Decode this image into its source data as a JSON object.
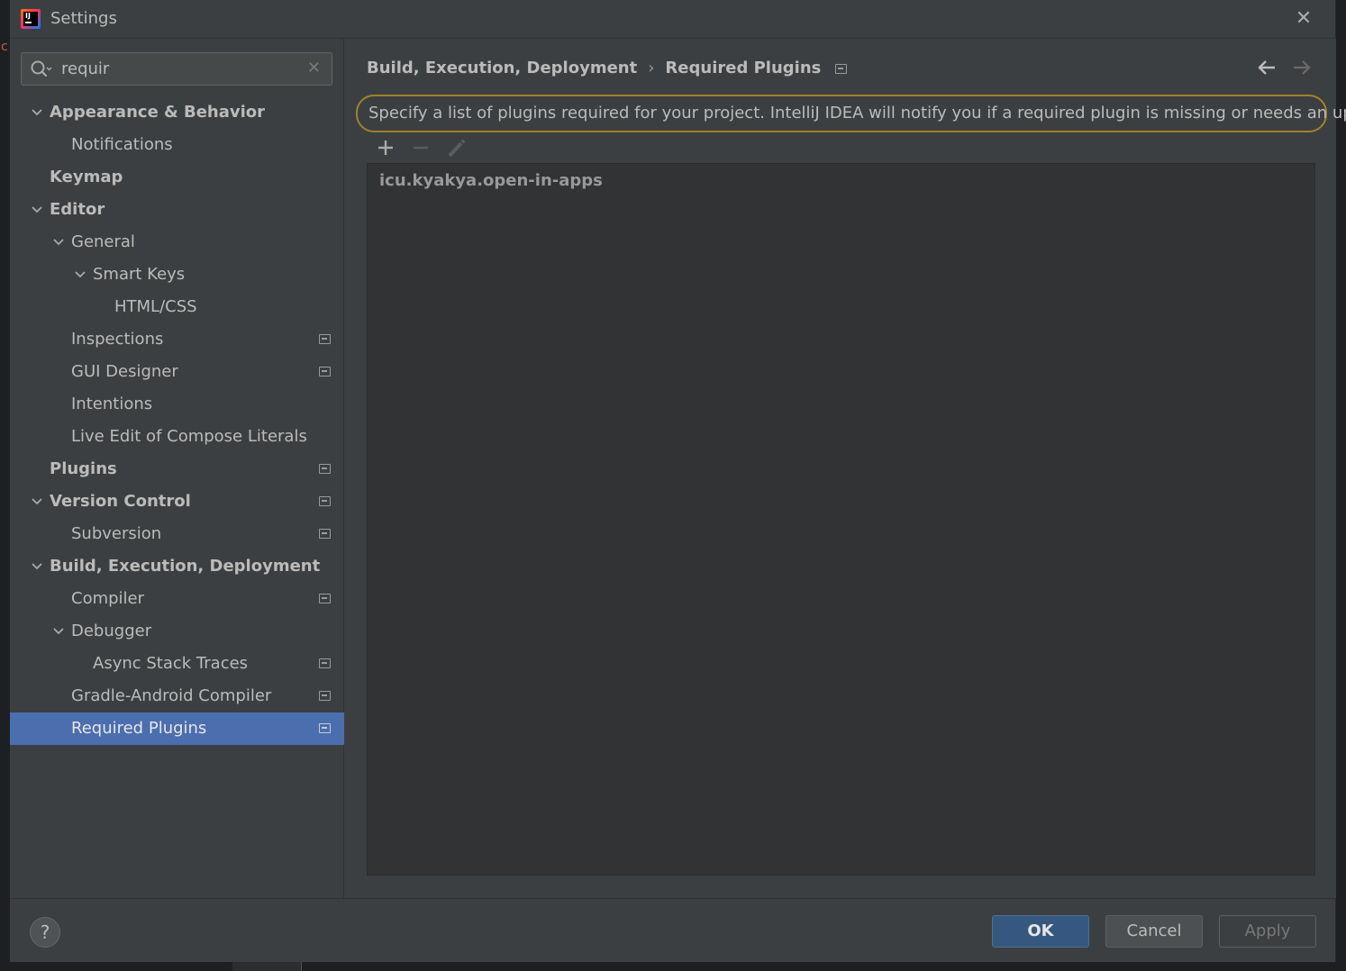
{
  "window": {
    "title": "Settings",
    "close_symbol": "✕"
  },
  "search": {
    "value": "requir",
    "clear_symbol": "✕"
  },
  "tree": [
    {
      "label": "Appearance & Behavior",
      "bold": true,
      "level": 0,
      "expanded": true,
      "project_icon": false,
      "selected": false
    },
    {
      "label": "Notifications",
      "bold": false,
      "level": 1,
      "expanded": null,
      "project_icon": false,
      "selected": false
    },
    {
      "label": "Keymap",
      "bold": true,
      "level": 0,
      "expanded": null,
      "project_icon": false,
      "selected": false
    },
    {
      "label": "Editor",
      "bold": true,
      "level": 0,
      "expanded": true,
      "project_icon": false,
      "selected": false
    },
    {
      "label": "General",
      "bold": false,
      "level": 1,
      "expanded": true,
      "project_icon": false,
      "selected": false
    },
    {
      "label": "Smart Keys",
      "bold": false,
      "level": 2,
      "expanded": true,
      "project_icon": false,
      "selected": false
    },
    {
      "label": "HTML/CSS",
      "bold": false,
      "level": 3,
      "expanded": null,
      "project_icon": false,
      "selected": false
    },
    {
      "label": "Inspections",
      "bold": false,
      "level": 1,
      "expanded": null,
      "project_icon": true,
      "selected": false
    },
    {
      "label": "GUI Designer",
      "bold": false,
      "level": 1,
      "expanded": null,
      "project_icon": true,
      "selected": false
    },
    {
      "label": "Intentions",
      "bold": false,
      "level": 1,
      "expanded": null,
      "project_icon": false,
      "selected": false
    },
    {
      "label": "Live Edit of Compose Literals",
      "bold": false,
      "level": 1,
      "expanded": null,
      "project_icon": false,
      "selected": false
    },
    {
      "label": "Plugins",
      "bold": true,
      "level": 0,
      "expanded": null,
      "project_icon": true,
      "selected": false
    },
    {
      "label": "Version Control",
      "bold": true,
      "level": 0,
      "expanded": true,
      "project_icon": true,
      "selected": false
    },
    {
      "label": "Subversion",
      "bold": false,
      "level": 1,
      "expanded": null,
      "project_icon": true,
      "selected": false
    },
    {
      "label": "Build, Execution, Deployment",
      "bold": true,
      "level": 0,
      "expanded": true,
      "project_icon": false,
      "selected": false
    },
    {
      "label": "Compiler",
      "bold": false,
      "level": 1,
      "expanded": null,
      "project_icon": true,
      "selected": false
    },
    {
      "label": "Debugger",
      "bold": false,
      "level": 1,
      "expanded": true,
      "project_icon": false,
      "selected": false
    },
    {
      "label": "Async Stack Traces",
      "bold": false,
      "level": 2,
      "expanded": null,
      "project_icon": true,
      "selected": false
    },
    {
      "label": "Gradle-Android Compiler",
      "bold": false,
      "level": 1,
      "expanded": null,
      "project_icon": true,
      "selected": false
    },
    {
      "label": "Required Plugins",
      "bold": false,
      "level": 1,
      "expanded": null,
      "project_icon": true,
      "selected": true
    }
  ],
  "main": {
    "breadcrumb": {
      "parent": "Build, Execution, Deployment",
      "separator": "›",
      "current": "Required Plugins"
    },
    "description": "Specify a list of plugins required for your project. IntelliJ IDEA will notify you if a required plugin is missing or needs an update.",
    "plugins": [
      "icu.kyakya.open-in-apps"
    ]
  },
  "footer": {
    "help_symbol": "?",
    "ok_label": "OK",
    "cancel_label": "Cancel",
    "apply_label": "Apply"
  },
  "icons": {
    "app": "intellij-logo-icon",
    "search": "search-icon",
    "back": "arrow-left-icon",
    "forward": "arrow-right-icon",
    "add": "plus-icon",
    "remove": "minus-icon",
    "edit": "pencil-icon",
    "project_level": "project-settings-icon",
    "chevron": "chevron-down-icon"
  },
  "colors": {
    "selection": "#4b6eaf",
    "primary_button": "#365880",
    "highlight_border": "#a0822e"
  }
}
